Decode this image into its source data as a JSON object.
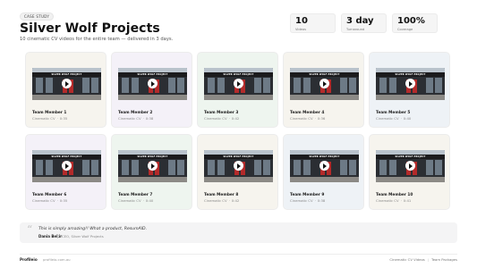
{
  "header": {
    "tag": "CASE STUDY",
    "title": "Silver Wolf Projects",
    "subtitle": "10 cinematic CV videos for the entire team — delivered in 3 days."
  },
  "stats": [
    {
      "value": "10",
      "label": "Videos"
    },
    {
      "value": "3 day",
      "label": "Turnaround"
    },
    {
      "value": "100%",
      "label": "Coverage"
    }
  ],
  "thumbnail": {
    "sign_text": "SILVER WOLF PROJECT"
  },
  "cards": [
    {
      "name": "Team Member 1",
      "type": "Cinematic CV",
      "duration": "0:35",
      "bg": "#f6f4ee"
    },
    {
      "name": "Team Member 2",
      "type": "Cinematic CV",
      "duration": "0:38",
      "bg": "#f4f1f8"
    },
    {
      "name": "Team Member 3",
      "type": "Cinematic CV",
      "duration": "0:42",
      "bg": "#eef5ef"
    },
    {
      "name": "Team Member 4",
      "type": "Cinematic CV",
      "duration": "0:36",
      "bg": "#f6f4ee"
    },
    {
      "name": "Team Member 5",
      "type": "Cinematic CV",
      "duration": "0:40",
      "bg": "#eef2f6"
    },
    {
      "name": "Team Member 6",
      "type": "Cinematic CV",
      "duration": "0:35",
      "bg": "#f4f1f8"
    },
    {
      "name": "Team Member 7",
      "type": "Cinematic CV",
      "duration": "0:40",
      "bg": "#eef5ef"
    },
    {
      "name": "Team Member 8",
      "type": "Cinematic CV",
      "duration": "0:42",
      "bg": "#f6f4ee"
    },
    {
      "name": "Team Member 9",
      "type": "Cinematic CV",
      "duration": "0:38",
      "bg": "#eef2f6"
    },
    {
      "name": "Team Member 10",
      "type": "Cinematic CV",
      "duration": "0:41",
      "bg": "#f6f4ee"
    }
  ],
  "testimonial": {
    "quote": "This is simply amazing!! What a product, ResumAID.",
    "author": "Dania Bekir",
    "role": "CEO, Silver Wolf Projects"
  },
  "footer": {
    "brand": "Profileio",
    "site": "profileio.com.au",
    "right_left": "Cinematic CV Videos",
    "right_right": "Team Packages"
  }
}
